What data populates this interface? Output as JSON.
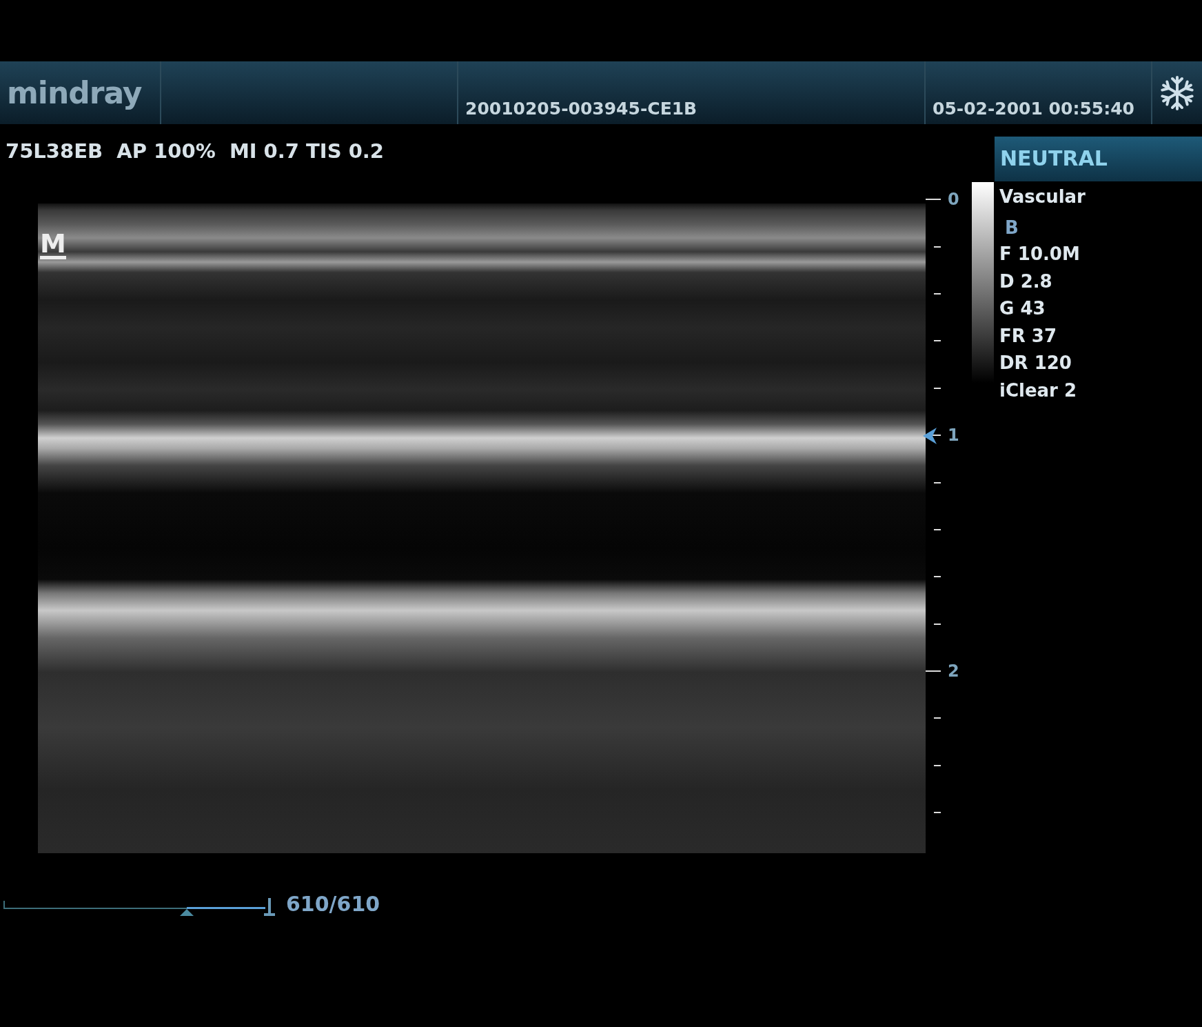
{
  "header": {
    "logo": "mindray",
    "exam_id": "20010205-003945-CE1B",
    "datetime": "05-02-2001 00:55:40"
  },
  "info_line": "75L38EB  AP 100%  MI 0.7 TIS 0.2",
  "image": {
    "orientation_mark": "M"
  },
  "depth_scale": {
    "labels": [
      {
        "text": "0",
        "focus": false
      },
      {
        "text": "1",
        "focus": true
      },
      {
        "text": "2",
        "focus": false
      }
    ]
  },
  "panel": {
    "title": "NEUTRAL",
    "params": [
      {
        "kind": "preset",
        "text": "Vascular"
      },
      {
        "kind": "mode",
        "text": "B"
      },
      {
        "kind": "param",
        "text": "F 10.0M"
      },
      {
        "kind": "param",
        "text": "D 2.8"
      },
      {
        "kind": "param",
        "text": "G 43"
      },
      {
        "kind": "param",
        "text": "FR 37"
      },
      {
        "kind": "param",
        "text": "DR 120"
      },
      {
        "kind": "param",
        "text": "iClear 2"
      }
    ]
  },
  "cine": {
    "level": 0.7,
    "counter": "610/610"
  }
}
